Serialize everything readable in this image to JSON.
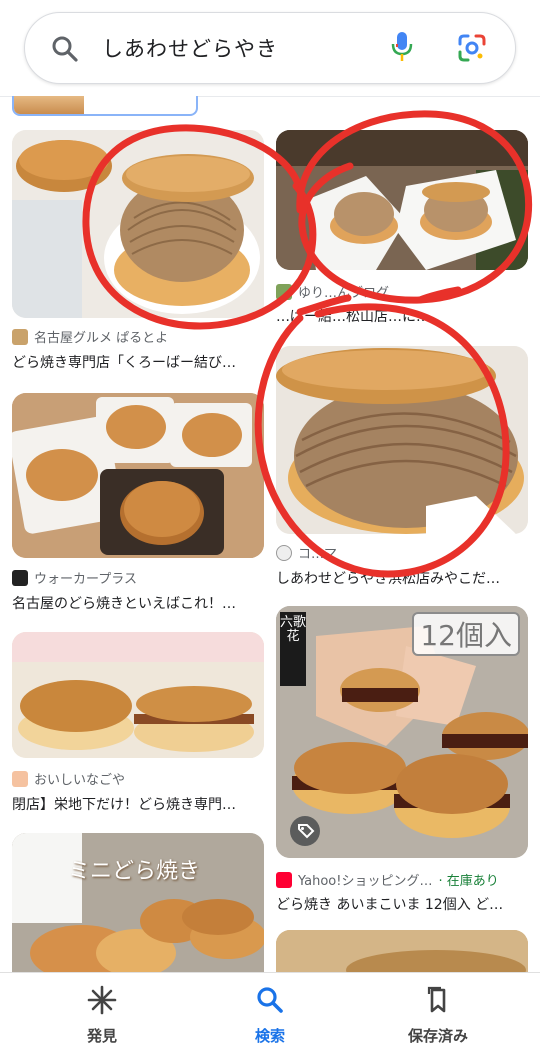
{
  "search": {
    "query": "しあわせどらやき"
  },
  "results": [
    {
      "source": "名古屋グルメ ぱるとよ",
      "title": "どら焼き専門店「くろーばー結び…"
    },
    {
      "source": "ゆり…んブログ",
      "title": "…ばー結…松山店…に…"
    },
    {
      "source": "コ…マ",
      "title": "しあわせどらやき浜松店みやこだ…"
    },
    {
      "source": "ウォーカープラス",
      "title": "名古屋のどら焼きといえばこれ！…"
    },
    {
      "source": "おいしいなごや",
      "title": "閉店】栄地下だけ！どら焼き専門…"
    },
    {
      "source": "Yahoo!ショッピング…",
      "stock": "· 在庫あり",
      "title": "どら焼き あいまこいま 12個入 ど…"
    }
  ],
  "overlays": {
    "count_badge": "12個入",
    "brand_mark": "六歌花",
    "mini_caption": "ミニどら焼き"
  },
  "nav": [
    {
      "label": "発見",
      "icon": "asterisk-icon"
    },
    {
      "label": "検索",
      "icon": "search-icon"
    },
    {
      "label": "保存済み",
      "icon": "bookmark-icon"
    }
  ],
  "colors": {
    "accent": "#1a73e8",
    "annotation": "#e8312a",
    "stock": "#188038"
  }
}
